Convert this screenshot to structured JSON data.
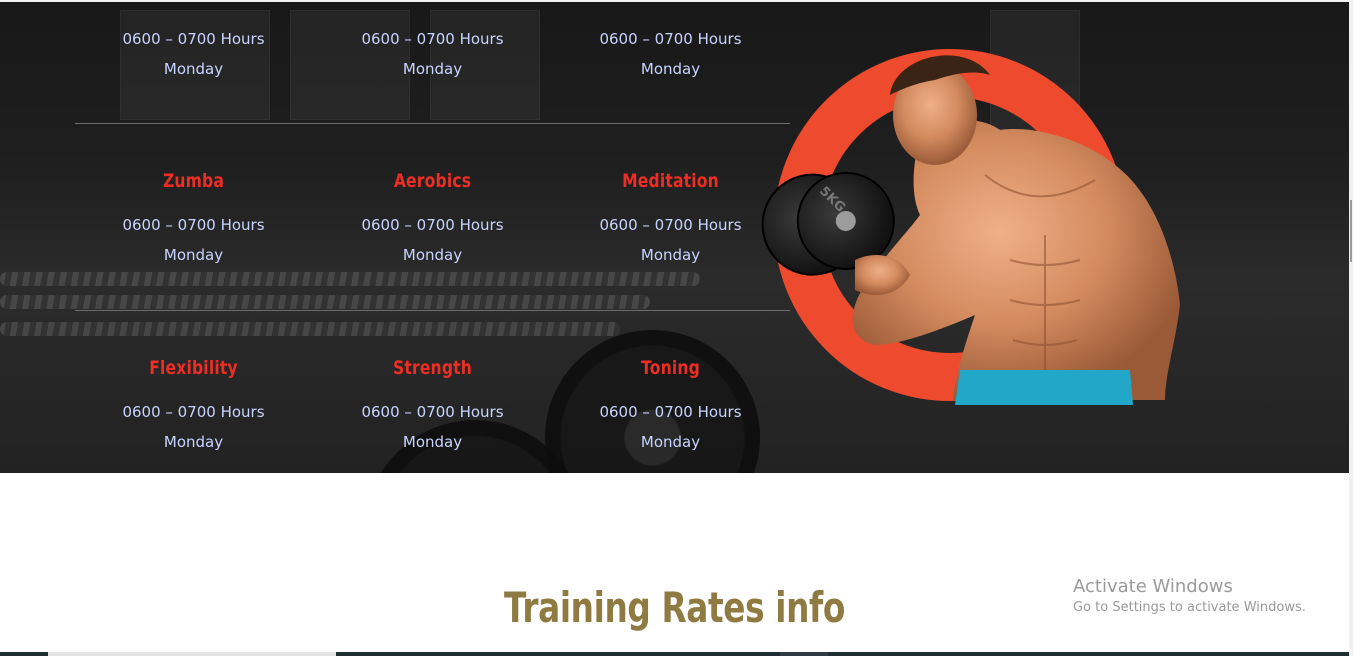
{
  "colors": {
    "accent": "#ee2d24",
    "schedule_text": "#c8d4ff",
    "title_gold": "#8f7a42",
    "dark_bg": "#1d1d1d"
  },
  "schedule": {
    "rows": [
      {
        "cells": [
          {
            "time": "0600 – 0700 Hours",
            "day": "Monday"
          },
          {
            "time": "0600 – 0700 Hours",
            "day": "Monday"
          },
          {
            "time": "0600 – 0700 Hours",
            "day": "Monday"
          }
        ]
      },
      {
        "cells": [
          {
            "name": "Zumba",
            "time": "0600 – 0700 Hours",
            "day": "Monday"
          },
          {
            "name": "Aerobics",
            "time": "0600 – 0700 Hours",
            "day": "Monday"
          },
          {
            "name": "Meditation",
            "time": "0600 – 0700 Hours",
            "day": "Monday"
          }
        ]
      },
      {
        "cells": [
          {
            "name": "Flexibility",
            "time": "0600 – 0700 Hours",
            "day": "Monday"
          },
          {
            "name": "Strength",
            "time": "0600 – 0700 Hours",
            "day": "Monday"
          },
          {
            "name": "Toning",
            "time": "0600 – 0700 Hours",
            "day": "Monday"
          }
        ]
      }
    ]
  },
  "hero": {
    "dumbbell_label": "5KG"
  },
  "rates": {
    "title": "Training Rates info"
  },
  "watermark": {
    "title": "Activate Windows",
    "subtitle": "Go to Settings to activate Windows."
  }
}
